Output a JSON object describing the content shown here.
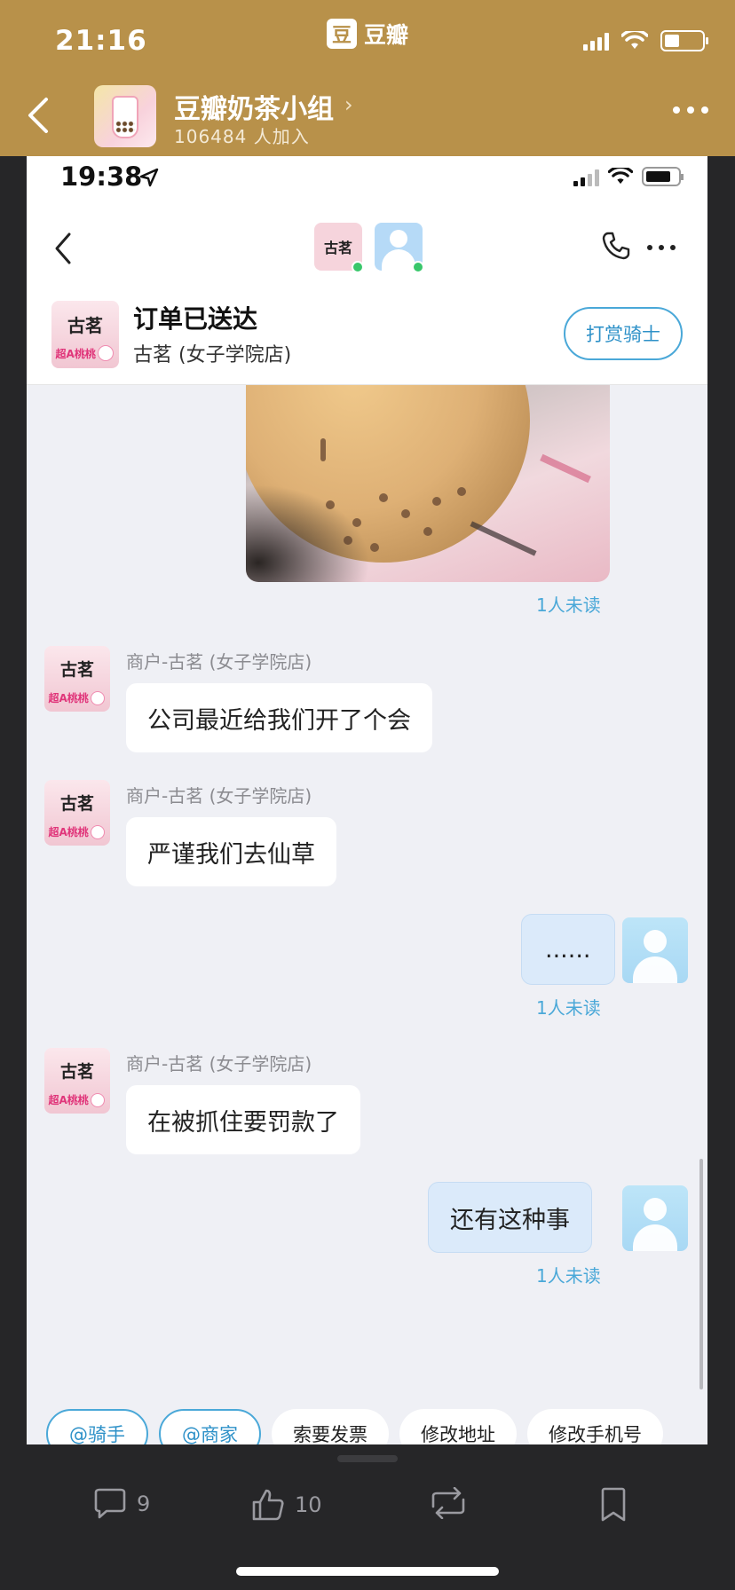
{
  "outer": {
    "time": "21:16",
    "app_logo_glyph": "豆",
    "app_name": "豆瓣",
    "group_name": "豆瓣奶茶小组",
    "group_members": "106484 人加入"
  },
  "inner": {
    "time": "19:38",
    "order_status": "订单已送达",
    "order_shop": "古茗 (女子学院店)",
    "tip_button": "打赏骑士",
    "shop_logo_text": "古茗",
    "shop_logo_sub": "超A桃桃",
    "messages": [
      {
        "type": "unread",
        "text": "1人未读"
      },
      {
        "sender": "商户-古茗 (女子学院店)",
        "text": "公司最近给我们开了个会"
      },
      {
        "sender": "商户-古茗 (女子学院店)",
        "text": "严谨我们去仙草"
      },
      {
        "sender": "me",
        "text": "......",
        "unread": "1人未读"
      },
      {
        "sender": "商户-古茗 (女子学院店)",
        "text": "在被抓住要罚款了"
      },
      {
        "sender": "me",
        "text": "还有这种事",
        "unread": "1人未读"
      }
    ],
    "quick_actions": [
      "@骑手",
      "@商家",
      "索要发票",
      "修改地址",
      "修改手机号"
    ]
  },
  "bottom": {
    "comments": "9",
    "likes": "10"
  },
  "colors": {
    "douban_header": "#b8914a",
    "accent_blue": "#4aa8d8",
    "chat_bg": "#eff0f5",
    "bubble_me": "#dbeafa"
  },
  "icons": [
    "back-icon",
    "more-icon",
    "call-icon",
    "location-icon",
    "wifi-icon",
    "battery-icon",
    "comment-icon",
    "like-icon",
    "repost-icon",
    "bookmark-icon"
  ]
}
